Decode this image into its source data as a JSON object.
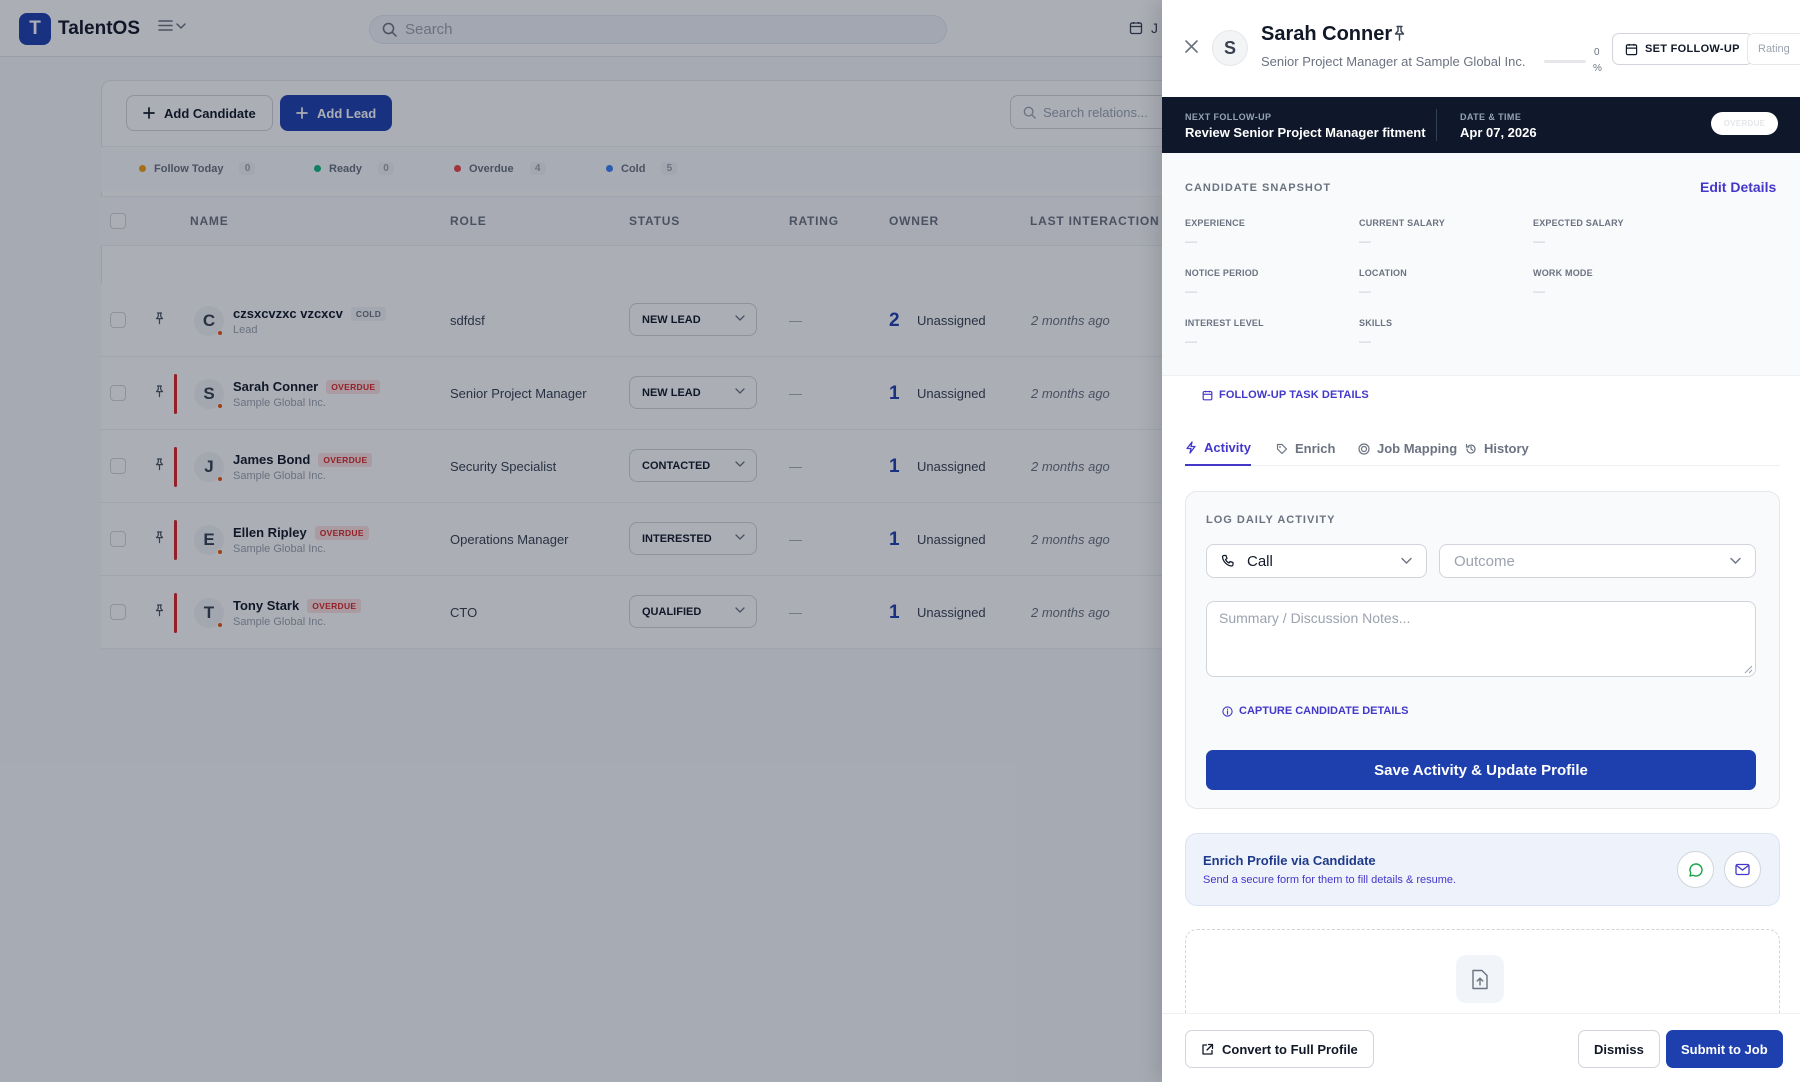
{
  "app": {
    "logo_letter": "T",
    "name": "TalentOS"
  },
  "topbar": {
    "search_placeholder": "Search",
    "right_text": "J"
  },
  "toolbar": {
    "add_candidate": "Add Candidate",
    "add_lead": "Add Lead",
    "search_relations_placeholder": "Search relations..."
  },
  "filters": [
    {
      "label": "Follow Today",
      "count": "0",
      "color": "#f59e0b"
    },
    {
      "label": "Ready",
      "count": "0",
      "color": "#10b981"
    },
    {
      "label": "Overdue",
      "count": "4",
      "color": "#ef4444"
    },
    {
      "label": "Cold",
      "count": "5",
      "color": "#3b82f6"
    }
  ],
  "table": {
    "headers": [
      "NAME",
      "ROLE",
      "STATUS",
      "RATING",
      "OWNER",
      "LAST INTERACTION"
    ],
    "rows": [
      {
        "initial": "C",
        "name": "czsxcvzxc vzcxcv",
        "tag": "COLD",
        "tag_type": "cold",
        "company": "Lead",
        "role": "sdfdsf",
        "status": "NEW LEAD",
        "rating": "—",
        "owner_count": "2",
        "owner": "Unassigned",
        "last": "2 months ago",
        "flagged": false
      },
      {
        "initial": "S",
        "name": "Sarah Conner",
        "tag": "OVERDUE",
        "tag_type": "over",
        "company": "Sample Global Inc.",
        "role": "Senior Project Manager",
        "status": "NEW LEAD",
        "rating": "—",
        "owner_count": "1",
        "owner": "Unassigned",
        "last": "2 months ago",
        "flagged": true
      },
      {
        "initial": "J",
        "name": "James Bond",
        "tag": "OVERDUE",
        "tag_type": "over",
        "company": "Sample Global Inc.",
        "role": "Security Specialist",
        "status": "CONTACTED",
        "rating": "—",
        "owner_count": "1",
        "owner": "Unassigned",
        "last": "2 months ago",
        "flagged": true
      },
      {
        "initial": "E",
        "name": "Ellen Ripley",
        "tag": "OVERDUE",
        "tag_type": "over",
        "company": "Sample Global Inc.",
        "role": "Operations Manager",
        "status": "INTERESTED",
        "rating": "—",
        "owner_count": "1",
        "owner": "Unassigned",
        "last": "2 months ago",
        "flagged": true
      },
      {
        "initial": "T",
        "name": "Tony Stark",
        "tag": "OVERDUE",
        "tag_type": "over",
        "company": "Sample Global Inc.",
        "role": "CTO",
        "status": "QUALIFIED",
        "rating": "—",
        "owner_count": "1",
        "owner": "Unassigned",
        "last": "2 months ago",
        "flagged": true
      }
    ]
  },
  "drawer": {
    "initial": "S",
    "name": "Sarah Conner",
    "subtitle": "Senior Project Manager at Sample Global Inc.",
    "completion": "0",
    "completion_unit": "%",
    "set_followup": "SET FOLLOW-UP",
    "rating_label": "Rating",
    "banner": {
      "next_label": "NEXT FOLLOW-UP",
      "next_value": "Review Senior Project Manager fitment",
      "date_label": "DATE & TIME",
      "date_value": "Apr 07, 2026",
      "pill": "OVERDUE"
    },
    "snapshot": {
      "title": "CANDIDATE SNAPSHOT",
      "edit": "Edit Details",
      "fields": [
        {
          "label": "EXPERIENCE",
          "value": "—"
        },
        {
          "label": "CURRENT SALARY",
          "value": "—"
        },
        {
          "label": "EXPECTED SALARY",
          "value": "—"
        },
        {
          "label": "NOTICE PERIOD",
          "value": "—"
        },
        {
          "label": "LOCATION",
          "value": "—"
        },
        {
          "label": "WORK MODE",
          "value": "—"
        },
        {
          "label": "INTEREST LEVEL",
          "value": "—"
        },
        {
          "label": "SKILLS",
          "value": "—"
        }
      ]
    },
    "followup_task_link": "FOLLOW-UP TASK DETAILS",
    "tabs": [
      "Activity",
      "Enrich",
      "Job Mapping",
      "History"
    ],
    "log": {
      "title": "LOG DAILY ACTIVITY",
      "type_value": "Call",
      "outcome_placeholder": "Outcome",
      "notes_placeholder": "Summary / Discussion Notes...",
      "capture_link": "CAPTURE CANDIDATE DETAILS",
      "save": "Save Activity & Update Profile"
    },
    "enrich": {
      "title": "Enrich Profile via Candidate",
      "subtitle": "Send a secure form for them to fill details & resume."
    },
    "footer": {
      "convert": "Convert to Full Profile",
      "dismiss": "Dismiss",
      "submit": "Submit to Job"
    }
  }
}
